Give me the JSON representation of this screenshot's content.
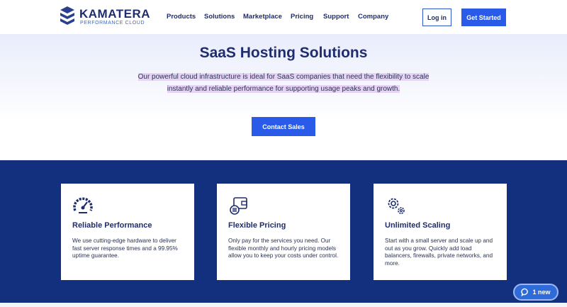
{
  "brand": {
    "name": "KAMATERA",
    "tagline": "PERFORMANCE CLOUD"
  },
  "nav": {
    "items": [
      {
        "label": "Products"
      },
      {
        "label": "Solutions"
      },
      {
        "label": "Marketplace"
      },
      {
        "label": "Pricing"
      },
      {
        "label": "Support"
      },
      {
        "label": "Company"
      }
    ],
    "login_label": "Log in",
    "get_started_label": "Get Started"
  },
  "hero": {
    "title": "SaaS Hosting Solutions",
    "description": "Our powerful cloud infrastructure is ideal for SaaS companies that need the flexibility to scale instantly and reliable performance for supporting usage peaks and growth.",
    "cta_label": "Contact Sales"
  },
  "features": [
    {
      "icon": "speedometer-icon",
      "title": "Reliable Performance",
      "description": "We use cutting-edge hardware to deliver fast server response times and a 99.95% uptime guarantee."
    },
    {
      "icon": "wallet-icon",
      "title": "Flexible Pricing",
      "description": "Only pay for the services you need. Our flexible monthly and hourly pricing models allow you to keep your costs under control."
    },
    {
      "icon": "gears-icon",
      "title": "Unlimited Scaling",
      "description": "Start with a small server and scale up and out as you grow. Quickly add load balancers, firewalls, private networks, and more."
    }
  ],
  "chat": {
    "label": "1 new"
  },
  "colors": {
    "brand_blue": "#2a5be8",
    "navy": "#13307f",
    "text_navy": "#1f2d6e"
  }
}
